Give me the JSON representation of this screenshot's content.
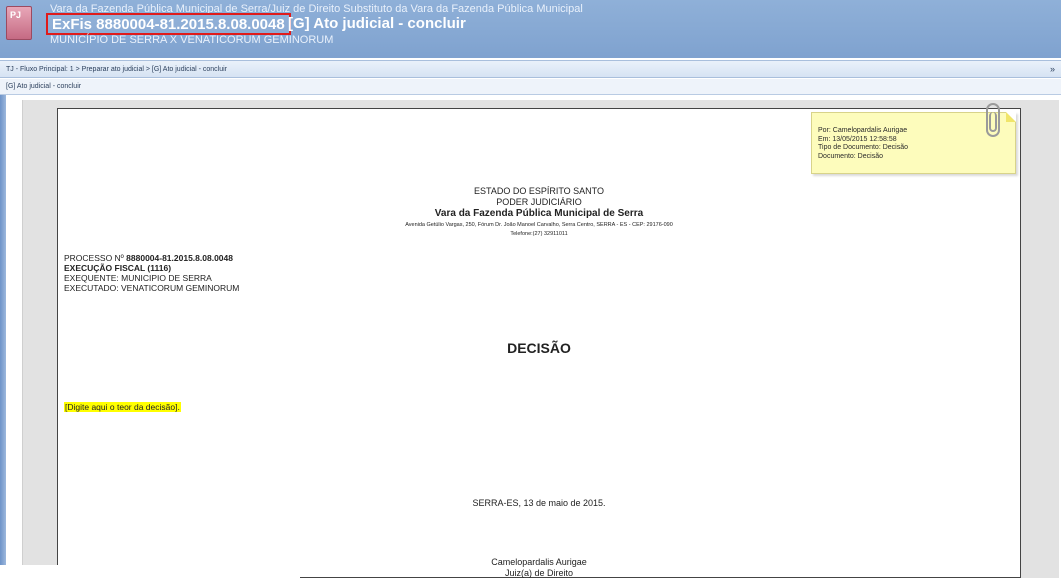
{
  "header": {
    "court_line": "Vara da Fazenda Pública Municipal de Serra/Juiz de Direito Substituto da Vara da Fazenda Pública Municipal",
    "process_number": "ExFis 8880004-81.2015.8.08.0048",
    "task_title": "[G] Ato judicial - concluir",
    "parties_line": "MUNICÍPIO DE SERRA X VENATICORUM GEMINORUM",
    "icon": "case-folder-icon"
  },
  "breadcrumb": {
    "text": "TJ - Fluxo Principal: 1 > Preparar ato judicial > [G] Ato judicial - concluir",
    "collapse": "»"
  },
  "task_bar": {
    "text": "[G] Ato judicial - concluir"
  },
  "sticky_note": {
    "author": "Por: Camelopardalis Aurigae",
    "date": "Em: 13/05/2015 12:58:58",
    "doc_type": "Tipo de Documento: Decisão",
    "document": "Documento: Decisão"
  },
  "document": {
    "state": "ESTADO DO ESPÍRITO SANTO",
    "judiciary": "PODER JUDICIÁRIO",
    "court": "Vara da Fazenda Pública Municipal de Serra",
    "address": "Avenida Getúlio Vargas, 250, Fórum Dr. João Manoel Carvalho, Serra Centro, SERRA - ES - CEP: 29176-090",
    "phone": "Telefone:(27) 32911011",
    "process_label": "PROCESSO Nº ",
    "process_value": "8880004-81.2015.8.08.0048",
    "class_line": "EXECUÇÃO FISCAL (1116)",
    "exequente": "EXEQUENTE: MUNICIPIO DE SERRA",
    "executado": "EXECUTADO: VENATICORUM GEMINORUM",
    "decision_title": "DECISÃO",
    "placeholder": "[Digite aqui o teor da decisão].",
    "place_date": "SERRA-ES, 13 de maio de 2015.",
    "signer_name": "Camelopardalis Aurigae",
    "signer_role": "Juiz(a) de Direito"
  }
}
